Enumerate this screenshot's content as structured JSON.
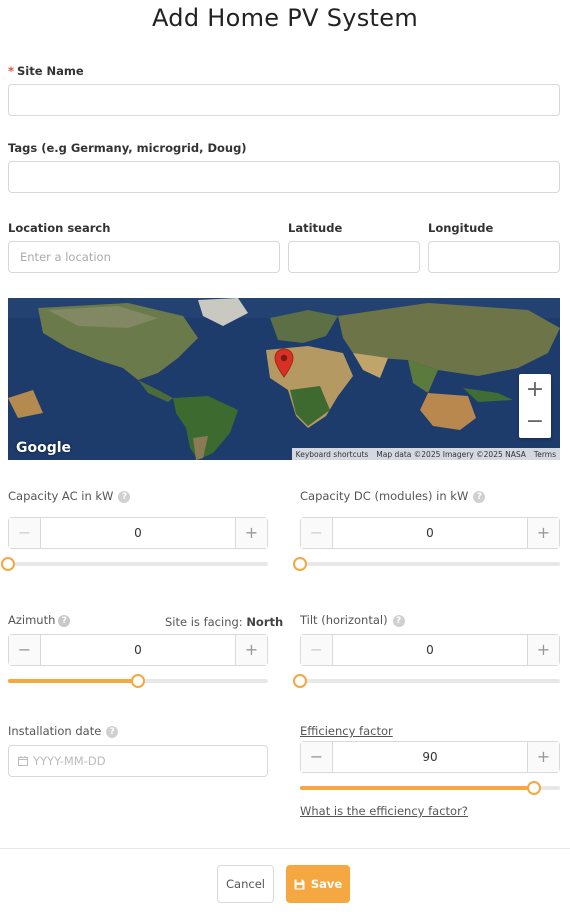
{
  "page": {
    "title": "Add Home PV System"
  },
  "form": {
    "site_name": {
      "label": "Site Name",
      "required": true,
      "value": ""
    },
    "tags": {
      "label": "Tags (e.g Germany, microgrid, Doug)",
      "value": ""
    },
    "location_search": {
      "label": "Location search",
      "placeholder": "Enter a location",
      "value": ""
    },
    "latitude": {
      "label": "Latitude",
      "value": ""
    },
    "longitude": {
      "label": "Longitude",
      "value": ""
    },
    "capacity_ac": {
      "label": "Capacity AC in kW",
      "value": "0",
      "slider_fraction": 0
    },
    "capacity_dc": {
      "label": "Capacity DC (modules) in kW",
      "value": "0",
      "slider_fraction": 0
    },
    "azimuth": {
      "label": "Azimuth",
      "value": "0",
      "facing_label": "Site is facing:",
      "facing_value": "North",
      "slider_fraction": 0.5
    },
    "tilt": {
      "label": "Tilt (horizontal)",
      "value": "0",
      "slider_fraction": 0
    },
    "installation_date": {
      "label": "Installation date",
      "placeholder": "YYYY-MM-DD",
      "value": ""
    },
    "efficiency_factor": {
      "label": "Efficiency factor",
      "value": "90",
      "slider_fraction": 0.9,
      "help_link": "What is the efficiency factor?"
    }
  },
  "stepper": {
    "minus": "−",
    "plus": "+"
  },
  "help_glyph": "?",
  "map": {
    "logo": "Google",
    "zoom_in": "+",
    "zoom_out": "−",
    "footer": {
      "shortcuts": "Keyboard shortcuts",
      "attribution": "Map data ©2025 Imagery ©2025 NASA",
      "terms": "Terms"
    },
    "marker_icon": "map-pin-icon"
  },
  "actions": {
    "cancel": "Cancel",
    "save": "Save",
    "save_icon": "floppy-disk-icon"
  },
  "colors": {
    "accent": "#f5a742",
    "marker": "#d93025",
    "required": "#e74c3c"
  }
}
